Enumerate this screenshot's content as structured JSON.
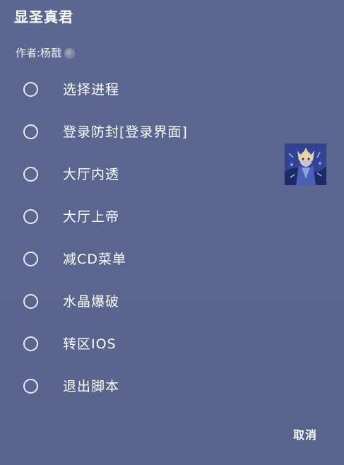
{
  "dialog": {
    "title": "显圣真君",
    "author": "作者:杨戬",
    "author_icon": "avatar-icon",
    "options": [
      {
        "label": "选择进程",
        "selected": false
      },
      {
        "label": "登录防封[登录界面]",
        "selected": false
      },
      {
        "label": "大厅内透",
        "selected": false
      },
      {
        "label": "大厅上帝",
        "selected": false
      },
      {
        "label": "减CD菜单",
        "selected": false
      },
      {
        "label": "水晶爆破",
        "selected": false
      },
      {
        "label": "转区IOS",
        "selected": false
      },
      {
        "label": "退出脚本",
        "selected": false
      }
    ],
    "cancel_label": "取消"
  },
  "colors": {
    "background": "#5a6690",
    "text": "#ffffff",
    "radio_border": "#e9ebf2"
  }
}
